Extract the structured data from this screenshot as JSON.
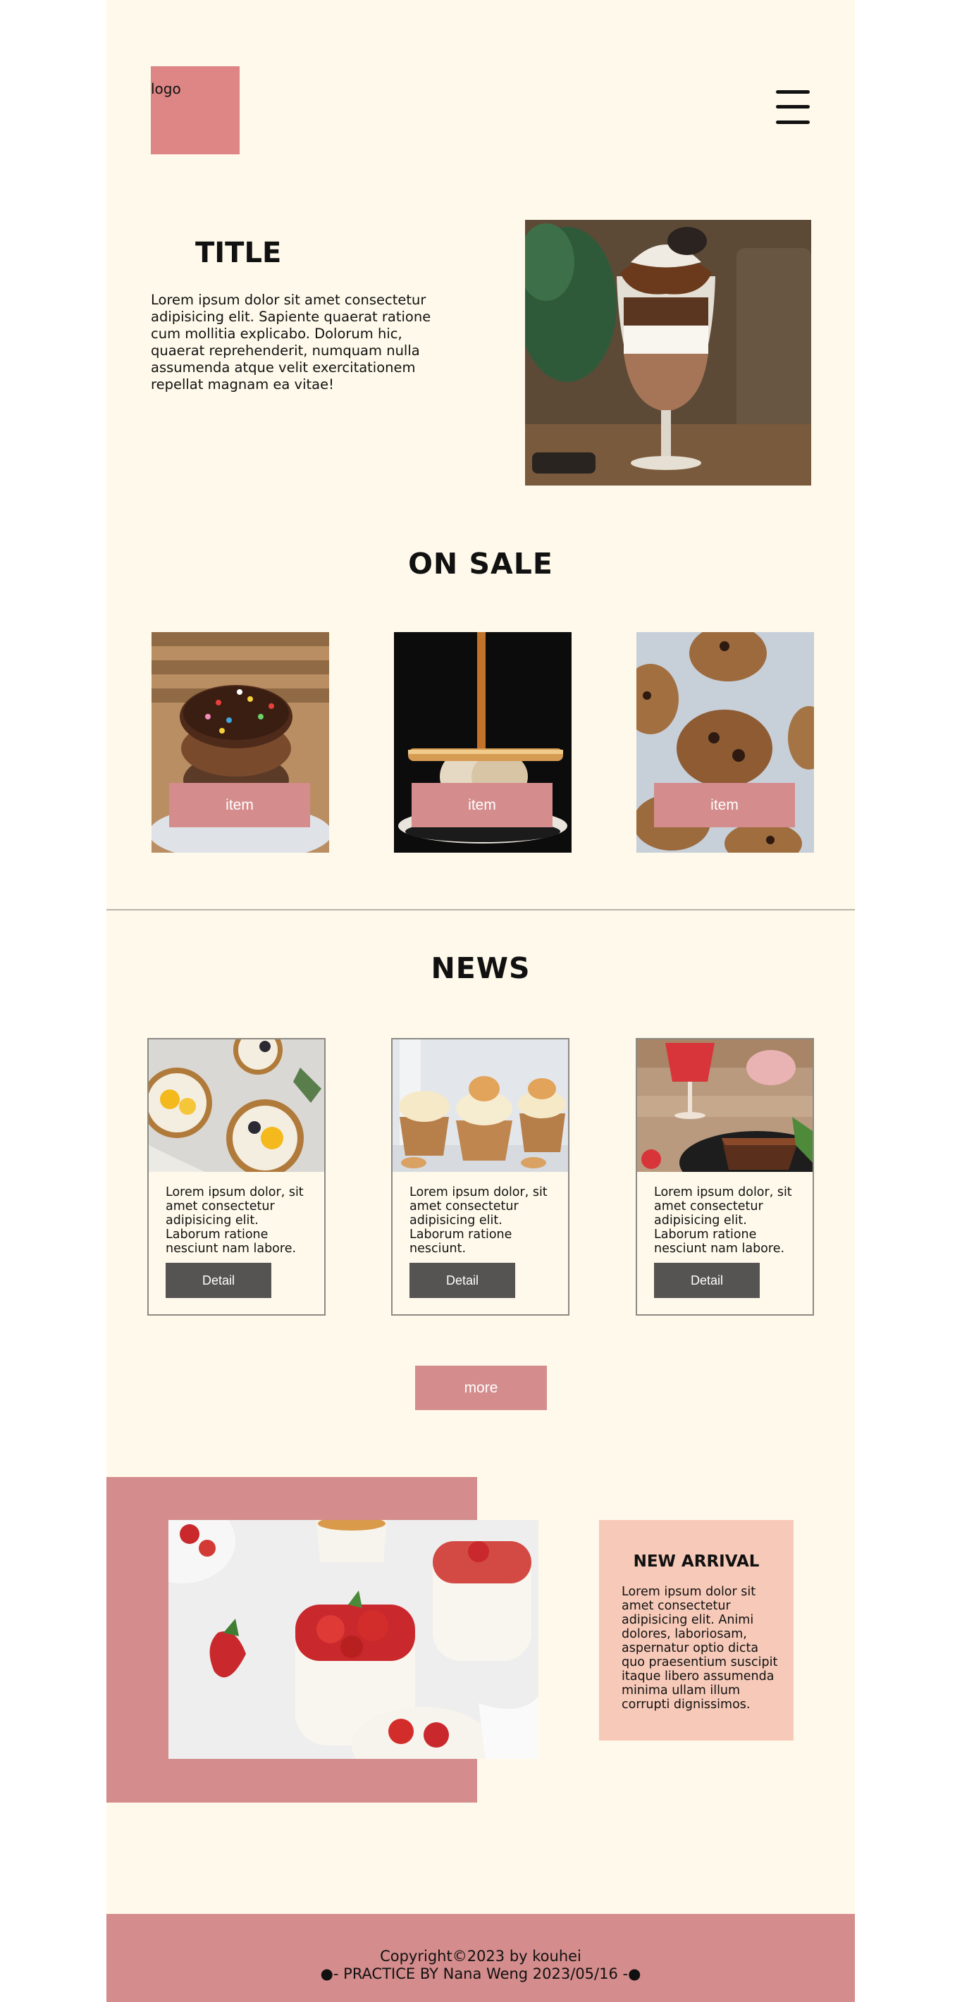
{
  "header": {
    "logo_text": "logo",
    "menu_icon": "hamburger-menu-icon"
  },
  "hero": {
    "title": "TITLE",
    "text": "Lorem ipsum dolor sit amet consectetur adipisicing elit. Sapiente quaerat ratione cum mollitia explicabo. Dolorum hic, quaerat reprehenderit, numquam nulla assumenda atque velit exercitationem repellat magnam ea vitae!"
  },
  "on_sale": {
    "title": "ON SALE",
    "items": [
      {
        "label": "item"
      },
      {
        "label": "item"
      },
      {
        "label": "item"
      }
    ]
  },
  "news": {
    "title": "NEWS",
    "cards": [
      {
        "text": "Lorem ipsum dolor, sit amet consectetur adipisicing elit. Laborum ratione nesciunt nam labore.",
        "button": "Detail"
      },
      {
        "text": "Lorem ipsum dolor, sit amet consectetur adipisicing elit. Laborum ratione nesciunt.",
        "button": "Detail"
      },
      {
        "text": "Lorem ipsum dolor, sit amet consectetur adipisicing elit. Laborum ratione nesciunt nam labore.",
        "button": "Detail"
      }
    ],
    "more_label": "more"
  },
  "new_arrival": {
    "title": "NEW ARRIVAL",
    "text": "Lorem ipsum dolor sit amet consectetur adipisicing elit. Animi dolores, laboriosam, aspernatur optio dicta quo praesentium suscipit itaque libero assumenda minima ullam illum corrupti dignissimos."
  },
  "footer": {
    "copyright": "Copyright©2023 by kouhei",
    "practice": "●- PRACTICE BY Nana Weng 2023/05/16 -●"
  },
  "colors": {
    "page_bg": "#fef9ea",
    "accent_pink": "#d48c8c",
    "logo_pink": "#de8686",
    "detail_gray": "#555453",
    "arrival_box": "#f6c9b8"
  }
}
